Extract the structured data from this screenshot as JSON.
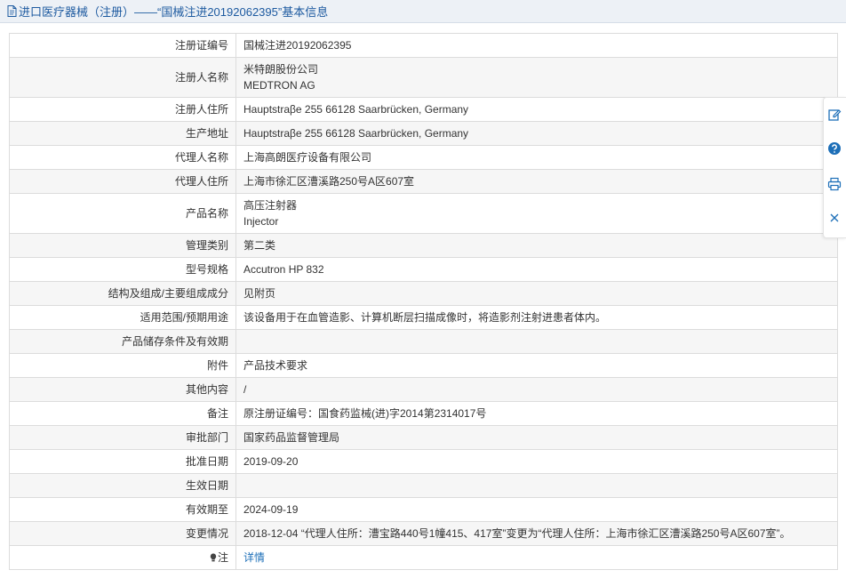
{
  "header": {
    "title": "进口医疗器械（注册）——“国械注进20192062395”基本信息"
  },
  "rows": [
    {
      "label": "注册证编号",
      "value": "国械注进20192062395"
    },
    {
      "label": "注册人名称",
      "value": "米特朗股份公司",
      "value2": "MEDTRON AG"
    },
    {
      "label": "注册人住所",
      "value": "Hauptstraβe 255 66128 Saarbrücken, Germany"
    },
    {
      "label": "生产地址",
      "value": "Hauptstraβe 255 66128 Saarbrücken, Germany"
    },
    {
      "label": "代理人名称",
      "value": "上海高朗医疗设备有限公司"
    },
    {
      "label": "代理人住所",
      "value": "上海市徐汇区漕溪路250号A区607室"
    },
    {
      "label": "产品名称",
      "value": "高压注射器",
      "value2": "Injector"
    },
    {
      "label": "管理类别",
      "value": "第二类"
    },
    {
      "label": "型号规格",
      "value": "Accutron HP 832"
    },
    {
      "label": "结构及组成/主要组成成分",
      "value": "见附页"
    },
    {
      "label": "适用范围/预期用途",
      "value": "该设备用于在血管造影、计算机断层扫描成像时，将造影剂注射进患者体内。"
    },
    {
      "label": "产品储存条件及有效期",
      "value": ""
    },
    {
      "label": "附件",
      "value": "产品技术要求"
    },
    {
      "label": "其他内容",
      "value": "/"
    },
    {
      "label": "备注",
      "value": "原注册证编号：国食药监械(进)字2014第2314017号"
    },
    {
      "label": "审批部门",
      "value": "国家药品监督管理局"
    },
    {
      "label": "批准日期",
      "value": "2019-09-20"
    },
    {
      "label": "生效日期",
      "value": ""
    },
    {
      "label": "有效期至",
      "value": "2024-09-19"
    },
    {
      "label": "变更情况",
      "value": "2018-12-04 “代理人住所：漕宝路440号1幢415、417室”变更为“代理人住所：上海市徐汇区漕溪路250号A区607室”。"
    },
    {
      "label": "注",
      "value": "详情"
    }
  ],
  "icons": {
    "header": "document-icon",
    "note": "bulb-icon",
    "toolbar": [
      "edit-icon",
      "help-icon",
      "print-icon",
      "close-icon"
    ]
  },
  "colors": {
    "header_bg": "#edf1f6",
    "header_text": "#1d5aa0",
    "link": "#1d6fb8",
    "alt_row": "#f6f6f6",
    "border": "#dcdcdc"
  }
}
